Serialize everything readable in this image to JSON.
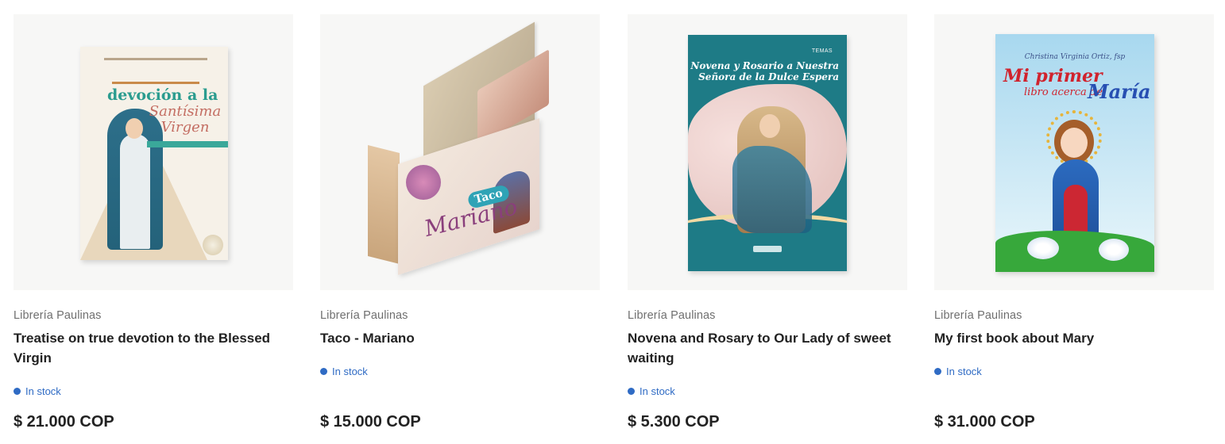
{
  "products": [
    {
      "vendor": "Librería Paulinas",
      "title": "Treatise on true devotion to the Blessed Virgin",
      "stock": "In stock",
      "price": "$ 21.000 COP",
      "cover": {
        "devocion": "devoción a la",
        "santisima": "Santísima Virgen"
      }
    },
    {
      "vendor": "Librería Paulinas",
      "title": "Taco - Mariano",
      "stock": "In stock",
      "price": "$ 15.000 COP",
      "cover": {
        "taco": "Taco",
        "mariano": "Mariano"
      }
    },
    {
      "vendor": "Librería Paulinas",
      "title": "Novena and Rosary to Our Lady of sweet waiting",
      "stock": "In stock",
      "price": "$ 5.300 COP",
      "cover": {
        "temas": "TEMAS",
        "title": "Novena y Rosario a Nuestra Señora de la Dulce Espera"
      }
    },
    {
      "vendor": "Librería Paulinas",
      "title": "My first book about Mary",
      "stock": "In stock",
      "price": "$ 31.000 COP",
      "cover": {
        "author": "Christina Virginia Ortiz, fsp",
        "mi_primer": "Mi primer",
        "libro": "libro acerca de",
        "maria": "María"
      }
    }
  ],
  "colors": {
    "stock_blue": "#2f6bc4",
    "text_dark": "#222222",
    "vendor_gray": "#6f6f6f"
  }
}
